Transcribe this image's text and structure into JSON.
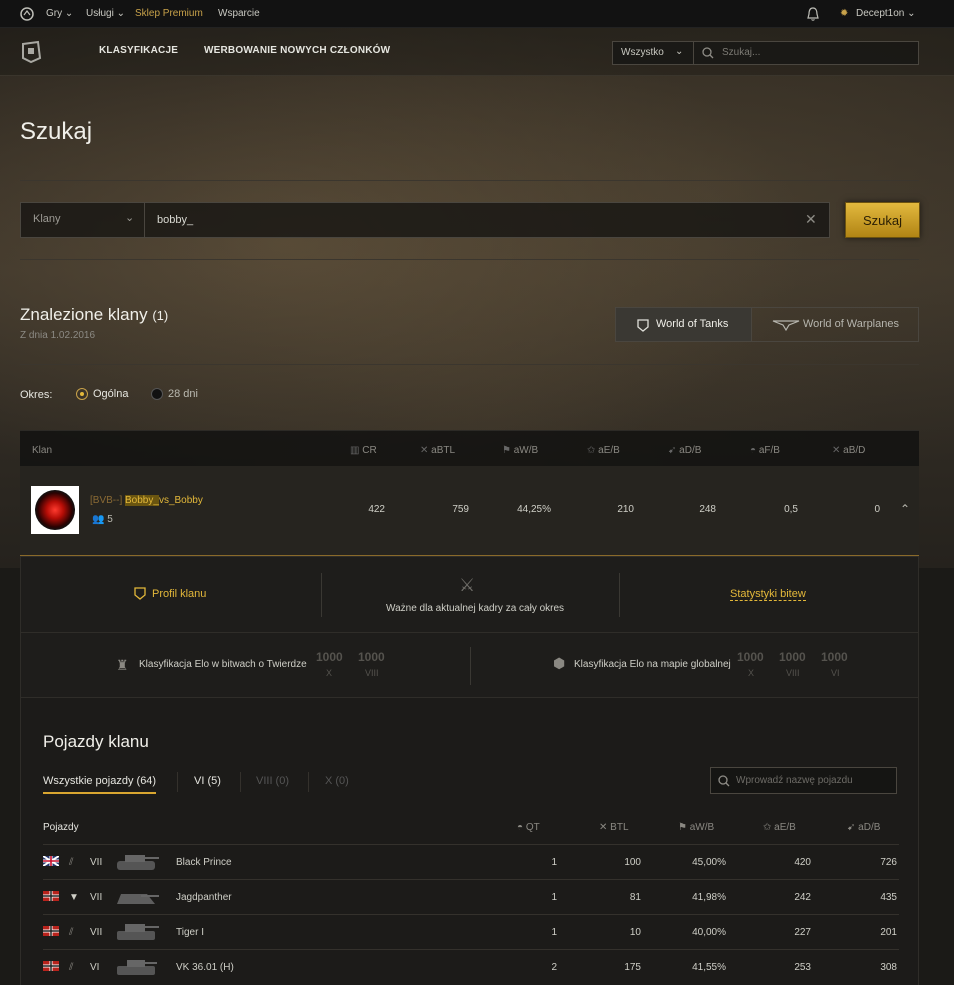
{
  "topbar": {
    "games": "Gry",
    "services": "Usługi",
    "premium_shop": "Sklep Premium",
    "support": "Wsparcie",
    "username": "Decept1on"
  },
  "nav": {
    "rankings": "KLASYFIKACJE",
    "recruiting": "WERBOWANIE NOWYCH CZŁONKÓW",
    "scope_select": "Wszystko",
    "search_placeholder": "Szukaj..."
  },
  "page": {
    "title": "Szukaj"
  },
  "search": {
    "type_select": "Klany",
    "query": "bobby_",
    "button": "Szukaj"
  },
  "results": {
    "title": "Znalezione klany",
    "count": "(1)",
    "date": "Z dnia 1.02.2016",
    "game_tabs": [
      "World of Tanks",
      "World of Warplanes"
    ],
    "period_label": "Okres:",
    "period_options": [
      "Ogólna",
      "28 dni"
    ]
  },
  "clan_table": {
    "headers": [
      "Klan",
      "CR",
      "aBTL",
      "aW/B",
      "aE/B",
      "aD/B",
      "aF/B",
      "aB/D"
    ],
    "row": {
      "tag": "[BVB--]",
      "name_highlight": "Bobby_",
      "name_rest": "vs_Bobby",
      "members": "5",
      "values": [
        "422",
        "759",
        "44,25%",
        "210",
        "248",
        "0,5",
        "0"
      ]
    }
  },
  "clan_detail": {
    "profile": "Profil klanu",
    "note": "Ważne dla aktualnej kadry za cały okres",
    "battle_stats": "Statystyki bitew",
    "elo_stronghold": {
      "label": "Klasyfikacja Elo w bitwach o Twierdze",
      "values": [
        "1000",
        "1000"
      ],
      "tiers": [
        "X",
        "VIII"
      ]
    },
    "elo_global": {
      "label": "Klasyfikacja Elo na mapie globalnej",
      "values": [
        "1000",
        "1000",
        "1000"
      ],
      "tiers": [
        "X",
        "VIII",
        "VI"
      ]
    }
  },
  "vehicles": {
    "title": "Pojazdy klanu",
    "tabs": [
      "Wszystkie pojazdy (64)",
      "VI (5)",
      "VIII (0)",
      "X (0)"
    ],
    "search_placeholder": "Wprowadź nazwę pojazdu",
    "headers": [
      "Pojazdy",
      "QT",
      "BTL",
      "aW/B",
      "aE/B",
      "aD/B"
    ],
    "rows": [
      {
        "nation": "uk",
        "tier": "VII",
        "name": "Black Prince",
        "qt": "1",
        "btl": "100",
        "wb": "45,00%",
        "eb": "420",
        "db": "726"
      },
      {
        "nation": "germany",
        "tier": "VII",
        "name": "Jagdpanther",
        "qt": "1",
        "btl": "81",
        "wb": "41,98%",
        "eb": "242",
        "db": "435"
      },
      {
        "nation": "germany",
        "tier": "VII",
        "name": "Tiger I",
        "qt": "1",
        "btl": "10",
        "wb": "40,00%",
        "eb": "227",
        "db": "201"
      },
      {
        "nation": "germany",
        "tier": "VI",
        "name": "VK 36.01 (H)",
        "qt": "2",
        "btl": "175",
        "wb": "41,55%",
        "eb": "253",
        "db": "308"
      }
    ]
  }
}
